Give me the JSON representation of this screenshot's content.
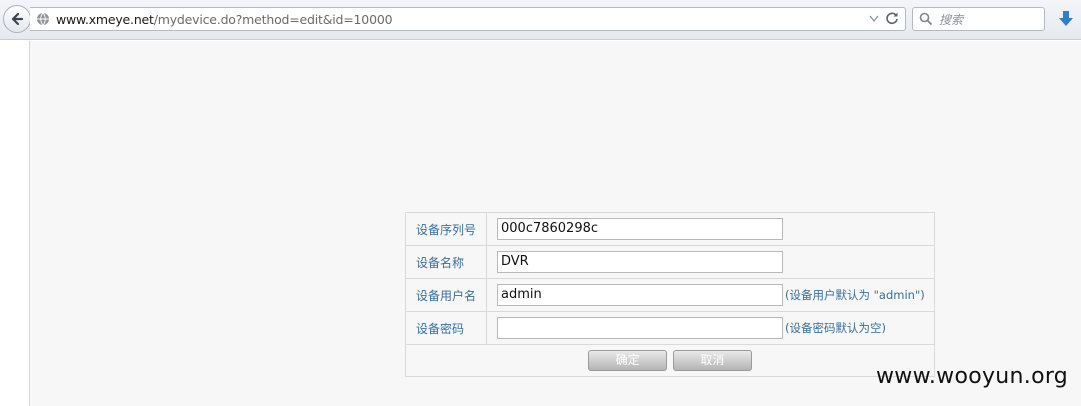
{
  "browser": {
    "url_host": "www.xmeye.net",
    "url_path": "/mydevice.do?method=edit&id=10000",
    "search_placeholder": "搜索"
  },
  "form": {
    "rows": [
      {
        "label": "设备序列号",
        "value": "000c7860298c",
        "hint": ""
      },
      {
        "label": "设备名称",
        "value": "DVR",
        "hint": ""
      },
      {
        "label": "设备用户名",
        "value": "admin",
        "hint": "(设备用户默认为 \"admin\")"
      },
      {
        "label": "设备密码",
        "value": "",
        "hint": "(设备密码默认为空)"
      }
    ],
    "confirm_label": "确定",
    "cancel_label": "取消"
  },
  "watermark": "www.wooyun.org"
}
